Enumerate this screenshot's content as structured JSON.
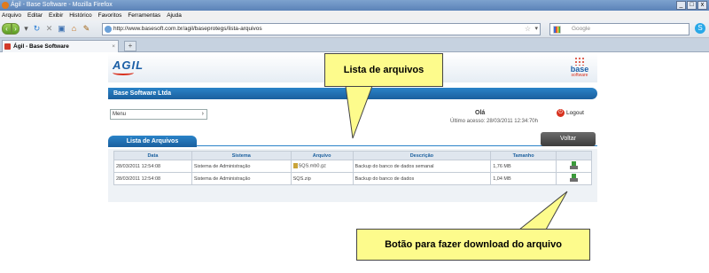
{
  "window": {
    "title": "Ágil - Base Software - Mozilla Firefox",
    "controls": [
      "_",
      "□",
      "x"
    ]
  },
  "menubar": {
    "items": [
      "Arquivo",
      "Editar",
      "Exibir",
      "Histórico",
      "Favoritos",
      "Ferramentas",
      "Ajuda"
    ]
  },
  "navbar": {
    "url": "http://www.basesoft.com.br/agil/baseprotegs/lista-arquivos",
    "search_placeholder": "Google"
  },
  "tabs": [
    {
      "label": "Ágil - Base Software"
    }
  ],
  "header": {
    "logo_left": "AGIL",
    "logo_right_word": "base",
    "logo_right_sub": "software"
  },
  "company": {
    "name": "Base Software Ltda"
  },
  "menu": {
    "label": "Menu",
    "arrow": "›"
  },
  "user": {
    "hello": "Olá",
    "last_access": "Último acesso: 28/03/2011 12:34:70h",
    "logout": "Logout"
  },
  "list": {
    "tab_label": "Lista de Arquivos",
    "back_button": "Voltar"
  },
  "table": {
    "headers": [
      "Data",
      "Sistema",
      "Arquivo",
      "Descrição",
      "Tamanho",
      ""
    ],
    "rows": [
      {
        "date": "28/03/2011 12:54:08",
        "system": "Sistema de Administração",
        "file": "SQS.mb0.gz",
        "description": "Backup do banco de dados semanal",
        "size": "1,76 MB"
      },
      {
        "date": "28/03/2011 12:54:08",
        "system": "Sistema de Administração",
        "file": "SQS.zip",
        "description": "Backup do banco de dados",
        "size": "1,04 MB"
      }
    ]
  },
  "callouts": {
    "top": "Lista de arquivos",
    "bottom": "Botão para fazer download do arquivo"
  },
  "colors": {
    "accent_blue": "#1a5f9e",
    "callout_yellow": "#fdfb8c",
    "logo_red": "#d8321f"
  }
}
